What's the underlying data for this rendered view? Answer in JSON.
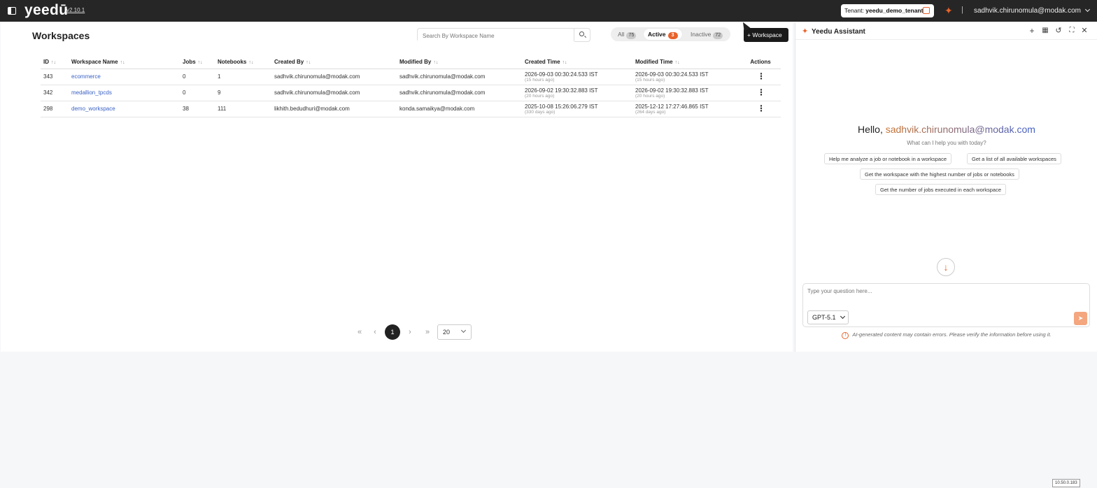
{
  "topbar": {
    "logo": "yeedū",
    "version": "v2.10.1",
    "tenant_label": "Tenant:",
    "tenant_value": "yeedu_demo_tenant",
    "user_email": "sadhvik.chirunomula@modak.com"
  },
  "workspaces": {
    "title": "Workspaces",
    "search_placeholder": "Search By Workspace Name",
    "filters": [
      {
        "label": "All",
        "count": "75"
      },
      {
        "label": "Active",
        "count": "3"
      },
      {
        "label": "Inactive",
        "count": "72"
      }
    ],
    "add_button": "+ Workspace",
    "columns": [
      "ID",
      "Workspace Name",
      "Jobs",
      "Notebooks",
      "Created By",
      "Modified By",
      "Created Time",
      "Modified Time",
      "Actions"
    ],
    "rows": [
      {
        "id": "343",
        "name": "ecommerce",
        "jobs": "0",
        "notebooks": "1",
        "created_by": "sadhvik.chirunomula@modak.com",
        "modified_by": "sadhvik.chirunomula@modak.com",
        "created_time": "2026-09-03 00:30:24.533 IST",
        "created_ago": "(15 hours ago)",
        "modified_time": "2026-09-03 00:30:24.533 IST",
        "modified_ago": "(15 hours ago)"
      },
      {
        "id": "342",
        "name": "medallion_tpcds",
        "jobs": "0",
        "notebooks": "9",
        "created_by": "sadhvik.chirunomula@modak.com",
        "modified_by": "sadhvik.chirunomula@modak.com",
        "created_time": "2026-09-02 19:30:32.883 IST",
        "created_ago": "(20 hours ago)",
        "modified_time": "2026-09-02 19:30:32.883 IST",
        "modified_ago": "(20 hours ago)"
      },
      {
        "id": "298",
        "name": "demo_workspace",
        "jobs": "38",
        "notebooks": "111",
        "created_by": "likhith.bedudhuri@modak.com",
        "modified_by": "konda.samaikya@modak.com",
        "created_time": "2025-10-08 15:26:06.279 IST",
        "created_ago": "(330 days ago)",
        "modified_time": "2025-12-12 17:27:46.865 IST",
        "modified_ago": "(264 days ago)"
      }
    ],
    "pagination": {
      "first": "«",
      "prev": "‹",
      "current_page": "1",
      "next": "›",
      "last": "»",
      "page_size": "20"
    }
  },
  "assistant": {
    "title": "Yeedu Assistant",
    "greeting_hello": "Hello, ",
    "greeting_email": "sadhvik.chirunomula@modak.com",
    "subtitle": "What can I help you with today?",
    "suggestions": [
      "Help me analyze a job or notebook in a workspace",
      "Get a list of all available workspaces",
      "Get the workspace with the highest number of jobs or notebooks",
      "Get the number of jobs executed in each workspace"
    ],
    "input_placeholder": "Type your question here...",
    "model": "GPT-5.1",
    "disclaimer": "AI-generated content may contain errors. Please verify the information before using it."
  },
  "footer": {
    "ip": "10.50.0.183"
  },
  "colors": {
    "accent": "#e8632b",
    "topbar": "#262626",
    "link": "#3b62c4"
  }
}
